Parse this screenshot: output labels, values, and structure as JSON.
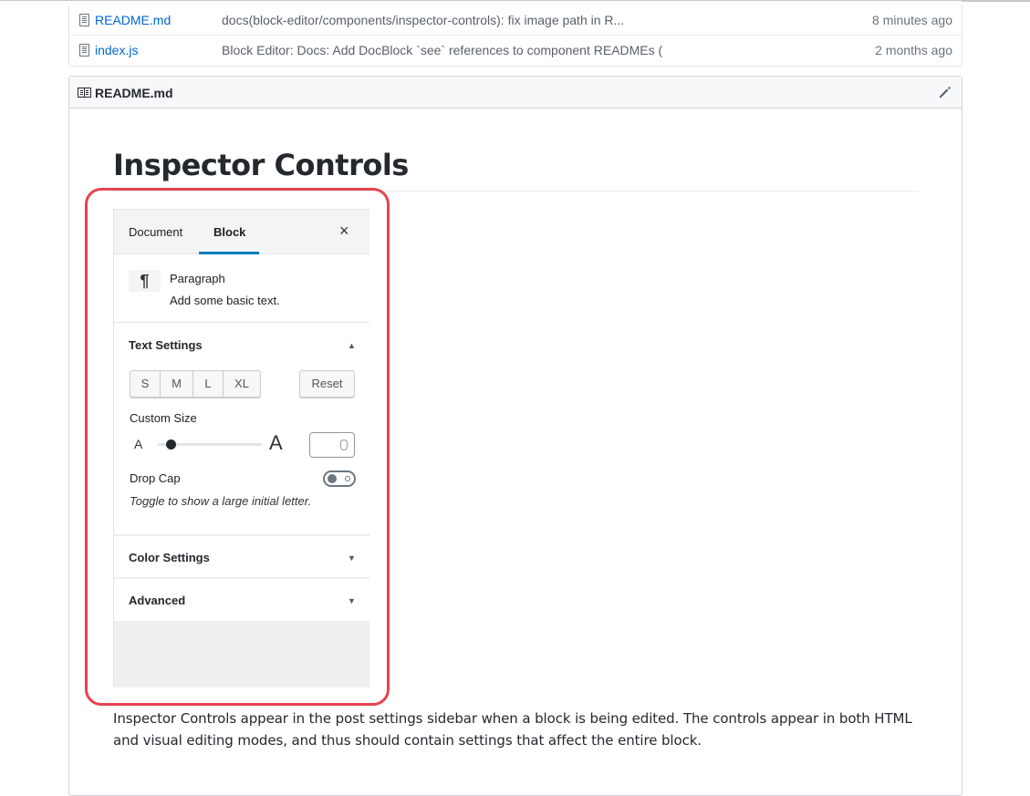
{
  "file_list": [
    {
      "name": "README.md",
      "message": "docs(block-editor/components/inspector-controls): fix image path in R...",
      "age": "8 minutes ago"
    },
    {
      "name": "index.js",
      "message": "Block Editor: Docs: Add DocBlock `see` references to component READMEs (",
      "age": "2 months ago"
    }
  ],
  "readme": {
    "file_name": "README.md",
    "heading": "Inspector Controls",
    "paragraph": "Inspector Controls appear in the post settings sidebar when a block is being edited. The controls appear in both HTML and visual editing modes, and thus should contain settings that affect the entire block."
  },
  "inspector": {
    "tabs": [
      {
        "label": "Document",
        "active": false
      },
      {
        "label": "Block",
        "active": true
      }
    ],
    "close_icon": "×",
    "block": {
      "icon": "¶",
      "name": "Paragraph",
      "description": "Add some basic text."
    },
    "text_settings": {
      "title": "Text Settings",
      "expanded": true,
      "sizes": [
        "S",
        "M",
        "L",
        "XL"
      ],
      "reset_label": "Reset",
      "custom_size_label": "Custom Size",
      "slider_small_label": "A",
      "slider_large_label": "A",
      "slider_value_fraction": 0.12,
      "custom_size_value": "",
      "drop_cap_label": "Drop Cap",
      "drop_cap_on": false,
      "drop_cap_help": "Toggle to show a large initial letter."
    },
    "color_settings": {
      "title": "Color Settings",
      "expanded": false
    },
    "advanced": {
      "title": "Advanced",
      "expanded": false
    },
    "caret_up": "▲",
    "caret_down": "▼"
  },
  "colors": {
    "link": "#0366d6",
    "tab_accent": "#007cba",
    "annotation": "#e8424f"
  }
}
